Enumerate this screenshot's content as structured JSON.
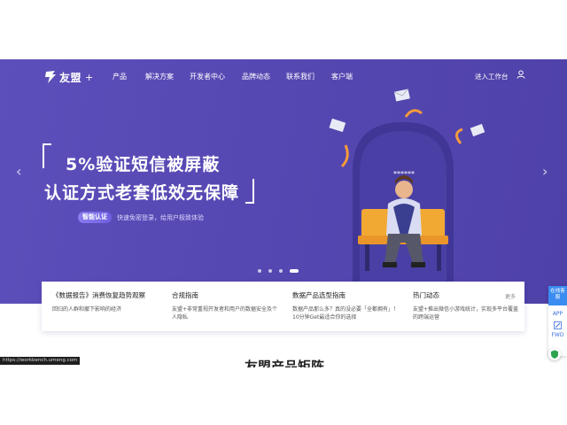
{
  "brand": {
    "name": "友盟",
    "plus": "+"
  },
  "nav": {
    "items": [
      {
        "label": "产品"
      },
      {
        "label": "解决方案"
      },
      {
        "label": "开发者中心"
      },
      {
        "label": "品牌动态"
      },
      {
        "label": "联系我们"
      },
      {
        "label": "客户端"
      }
    ],
    "workspace_label": "进入工作台",
    "user_icon": "user-icon"
  },
  "hero": {
    "headline_1": "5%验证短信被屏蔽",
    "headline_2": "认证方式老套低效无保障",
    "badge": "智能认证",
    "subtitle": "快速免密登录，给用户极致体验",
    "carousel_total": 4,
    "carousel_active": 4,
    "colors": {
      "background": "#5a4bb6",
      "accent": "#f59a3c"
    }
  },
  "info": {
    "cells": [
      {
        "title": "《数据报告》消费恢复趋势观察",
        "desc": "回归的人群和撤下影响的经济"
      },
      {
        "title": "合规指南",
        "desc": "友盟+非常重视开发者和用户的数据安全及个人隐私"
      },
      {
        "title": "数据产品选型指南",
        "desc": "数据产品那么多？真的没必要「全都拥有」！10分钟Get最适合你的选择"
      },
      {
        "title": "热门动态",
        "desc": "友盟+推出微信小游戏统计，实现多平台覆盖的跨端运营"
      }
    ],
    "more": "更多"
  },
  "float_bar": {
    "top": "在线客服",
    "app": "APP",
    "edit_icon": "edit-icon",
    "fwd": "FWD"
  },
  "status_url": "https://workbench.umeng.com",
  "section_title": "友盟产品矩阵"
}
